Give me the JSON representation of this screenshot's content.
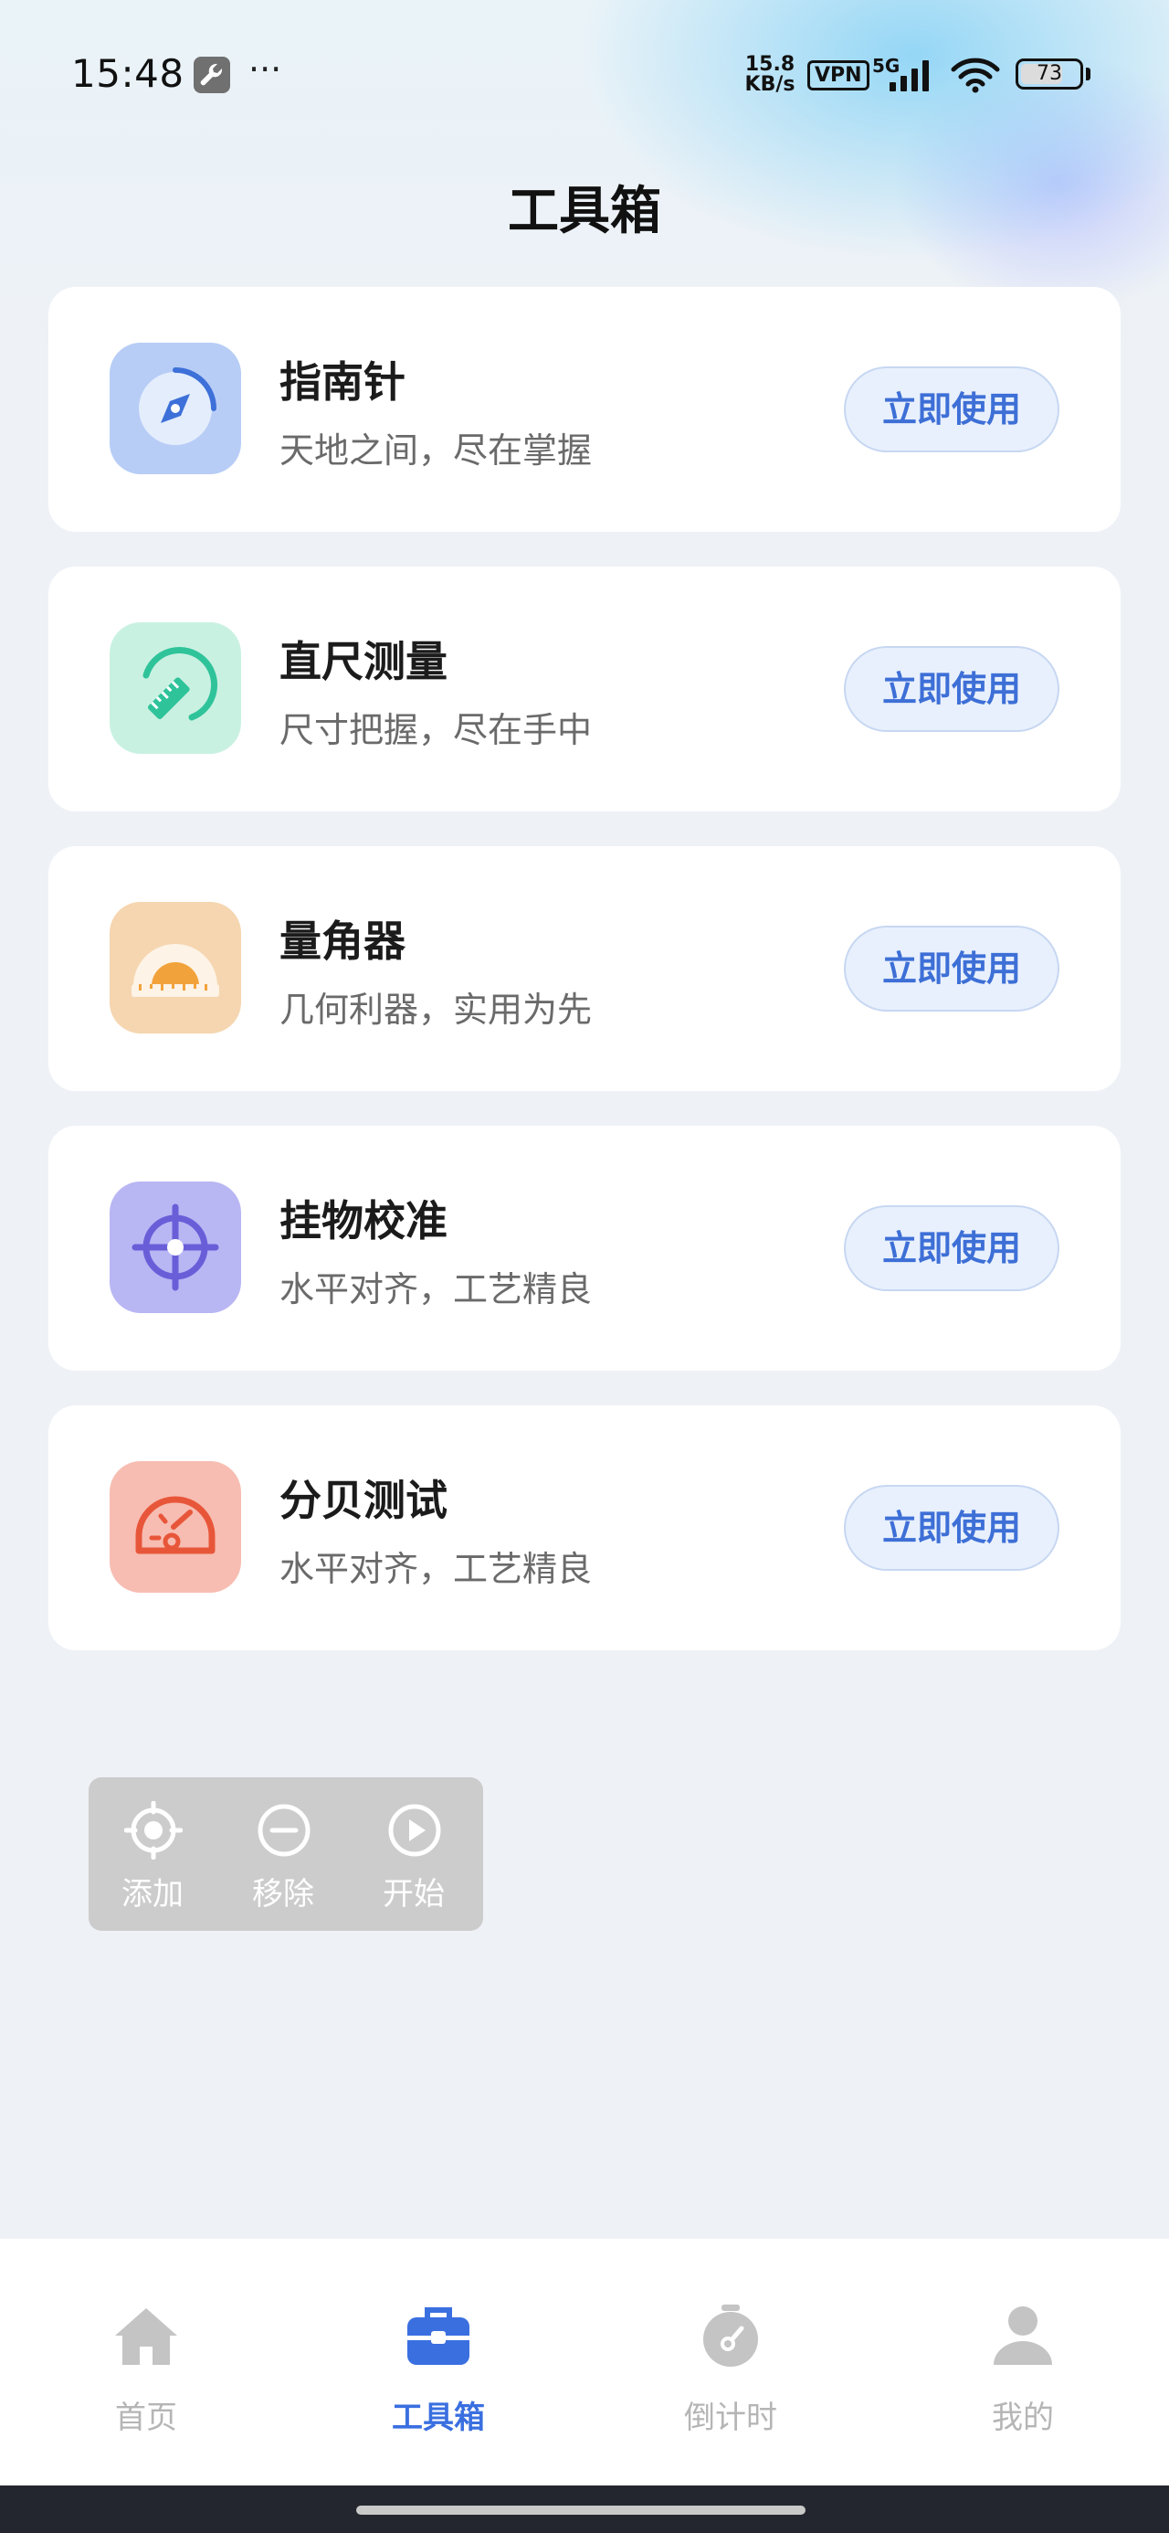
{
  "status_bar": {
    "time": "15:48",
    "dots": "···",
    "net_speed_value": "15.8",
    "net_speed_unit": "KB/s",
    "vpn": "VPN",
    "network": "5G",
    "battery": "73",
    "battery_level": 0.73
  },
  "header": {
    "title": "工具箱"
  },
  "tools": [
    {
      "name": "指南针",
      "desc": "天地之间，尽在掌握",
      "button": "立即使用",
      "icon": "compass-icon",
      "color": "#b7cdf6"
    },
    {
      "name": "直尺测量",
      "desc": "尺寸把握，尽在手中",
      "button": "立即使用",
      "icon": "ruler-icon",
      "color": "#c9f1e1"
    },
    {
      "name": "量角器",
      "desc": "几何利器，实用为先",
      "button": "立即使用",
      "icon": "protractor-icon",
      "color": "#f5d6b0"
    },
    {
      "name": "挂物校准",
      "desc": "水平对齐，工艺精良",
      "button": "立即使用",
      "icon": "crosshair-icon",
      "color": "#b9b6f4"
    },
    {
      "name": "分贝测试",
      "desc": "水平对齐，工艺精良",
      "button": "立即使用",
      "icon": "decibel-meter-icon",
      "color": "#f7bdb2"
    }
  ],
  "float_panel": {
    "add": "添加",
    "remove": "移除",
    "start": "开始"
  },
  "nav": {
    "home": "首页",
    "toolbox": "工具箱",
    "countdown": "倒计时",
    "mine": "我的"
  },
  "colors": {
    "accent": "#3a6fe0",
    "button_bg": "#e8f0fd",
    "nav_inactive": "#b5b5b5"
  }
}
